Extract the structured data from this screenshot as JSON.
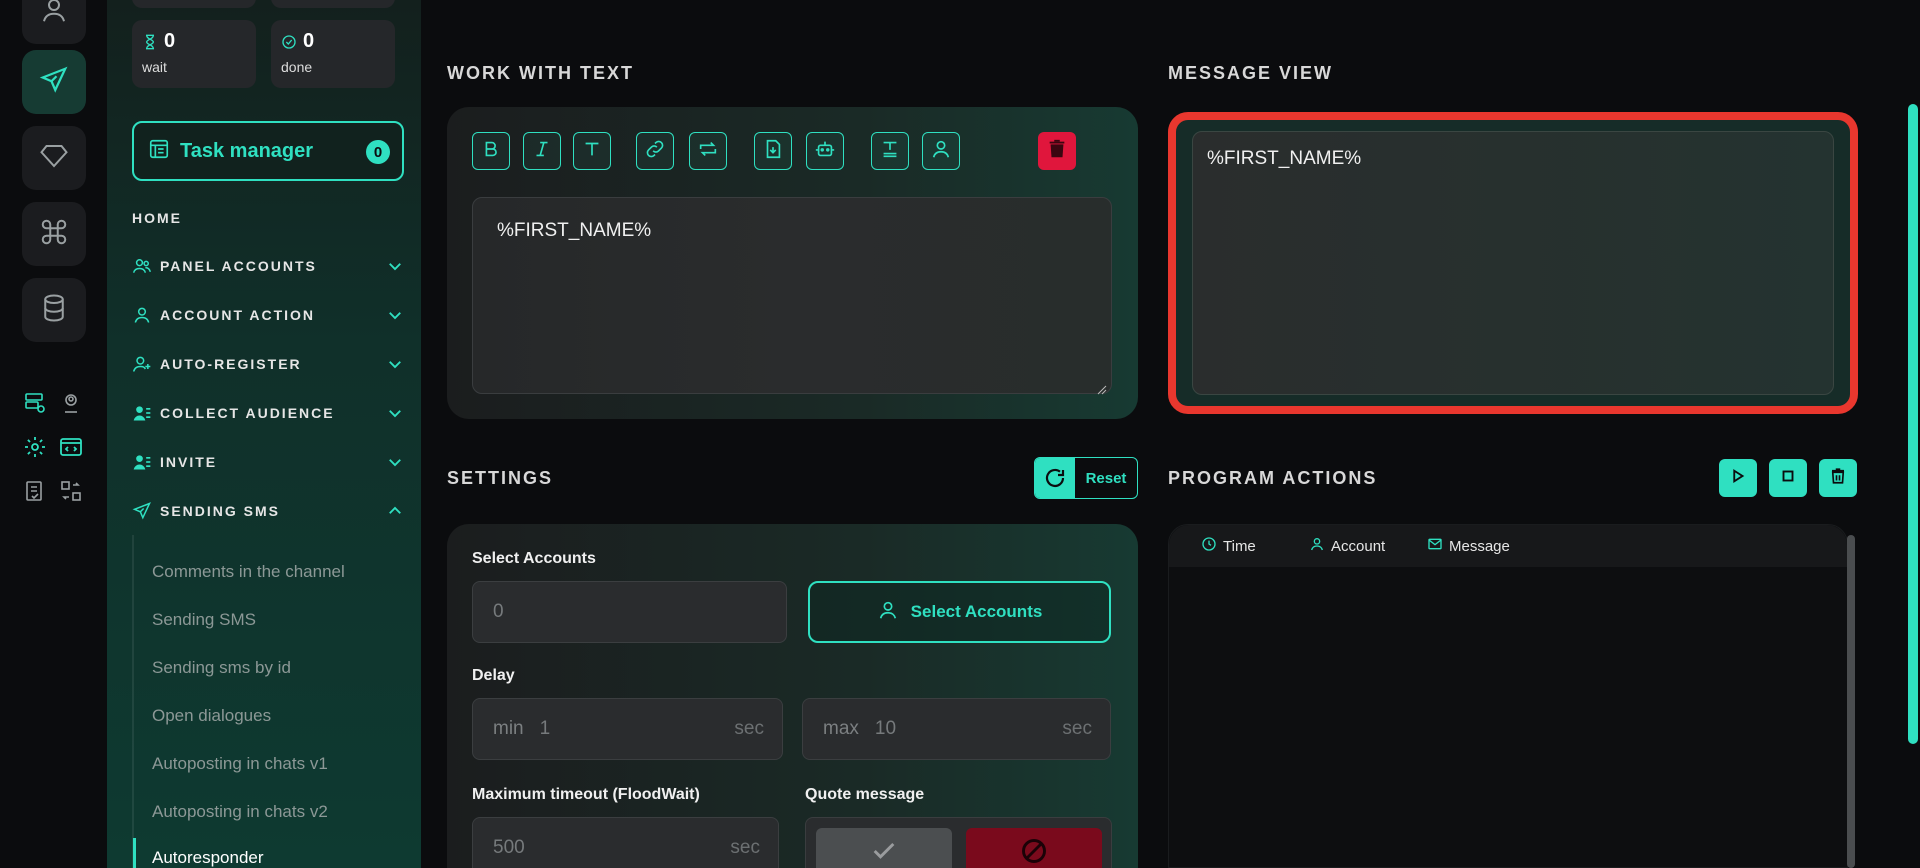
{
  "counters": [
    {
      "icon": "hourglass-icon",
      "value": "0",
      "label": "wait"
    },
    {
      "icon": "check-circle-icon",
      "value": "0",
      "label": "done"
    }
  ],
  "task_manager": {
    "label": "Task manager",
    "badge": "0"
  },
  "nav": {
    "home": "HOME",
    "items": [
      {
        "label": "PANEL ACCOUNTS",
        "icon": "users-icon",
        "expanded": false
      },
      {
        "label": "ACCOUNT ACTION",
        "icon": "user-icon",
        "expanded": false
      },
      {
        "label": "AUTO-REGISTER",
        "icon": "user-plus-icon",
        "expanded": false
      },
      {
        "label": "COLLECT AUDIENCE",
        "icon": "user-list-icon",
        "expanded": false
      },
      {
        "label": "INVITE",
        "icon": "user-list-icon",
        "expanded": false
      },
      {
        "label": "SENDING SMS",
        "icon": "send-icon",
        "expanded": true
      }
    ],
    "sub_items": [
      "Comments in the channel",
      "Sending SMS",
      "Sending sms by id",
      "Open dialogues",
      "Autoposting in chats v1",
      "Autoposting in chats v2",
      "Autoresponder"
    ],
    "active_sub": "Autoresponder"
  },
  "work_with_text": {
    "title": "WORK WITH TEXT",
    "toolbar": [
      "bold-icon",
      "italic-icon",
      "text-icon",
      "link-icon",
      "repeat-icon",
      "file-import-icon",
      "bot-icon",
      "text-align-icon",
      "user-icon",
      "trash-icon"
    ],
    "text": "%FIRST_NAME%"
  },
  "message_view": {
    "title": "MESSAGE VIEW",
    "text": "%FIRST_NAME%"
  },
  "settings": {
    "title": "SETTINGS",
    "reset_label": "Reset",
    "select_accounts_label": "Select Accounts",
    "select_accounts_value": "0",
    "select_accounts_button": "Select Accounts",
    "delay_label": "Delay",
    "delay_min_prefix": "min",
    "delay_min": "1",
    "delay_max_prefix": "max",
    "delay_max": "10",
    "unit": "sec",
    "timeout_label": "Maximum timeout (FloodWait)",
    "timeout_value": "500",
    "quote_label": "Quote message"
  },
  "program_actions": {
    "title": "PROGRAM ACTIONS",
    "columns": [
      "Time",
      "Account",
      "Message"
    ]
  },
  "colors": {
    "accent": "#2fe0c1",
    "danger": "#e0163c",
    "highlight": "#e9372e"
  }
}
